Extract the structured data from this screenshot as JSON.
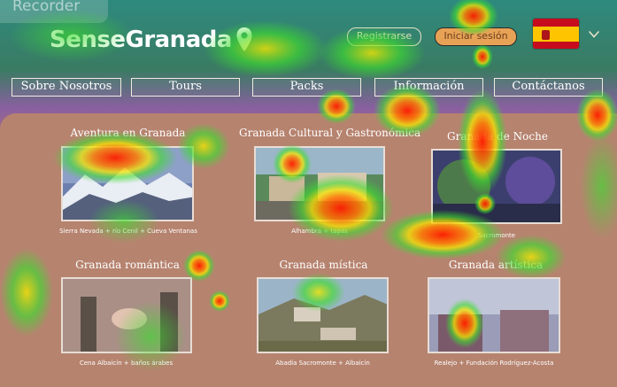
{
  "recorder": {
    "label": "Recorder"
  },
  "header": {
    "brand": "SenseGranada",
    "register_label": "Registrarse",
    "login_label": "Iniciar sesión",
    "language_flag": "spain-flag-icon"
  },
  "nav": {
    "items": [
      {
        "label": "Sobre Nosotros"
      },
      {
        "label": "Tours"
      },
      {
        "label": "Packs"
      },
      {
        "label": "Información"
      },
      {
        "label": "Contáctanos"
      }
    ]
  },
  "cards": [
    {
      "title": "Aventura en Granada",
      "caption": "Sierra Nevada + río Cenil + Cueva Ventanas"
    },
    {
      "title": "Granada Cultural y Gastronómica",
      "caption": "Alhambra + tapas"
    },
    {
      "title": "Granada de Noche",
      "caption": "Sacromonte"
    },
    {
      "title": "Granada romántica",
      "caption": "Cena Albaicín + baños árabes"
    },
    {
      "title": "Granada mística",
      "caption": "Abadía Sacromonte + Albaicín"
    },
    {
      "title": "Granada artística",
      "caption": "Realejo + Fundación Rodríguez-Acosta"
    }
  ],
  "colors": {
    "accent_orange": "#e7a255",
    "panel_brown": "#b6836f",
    "header_green": "#2e8a7e"
  }
}
